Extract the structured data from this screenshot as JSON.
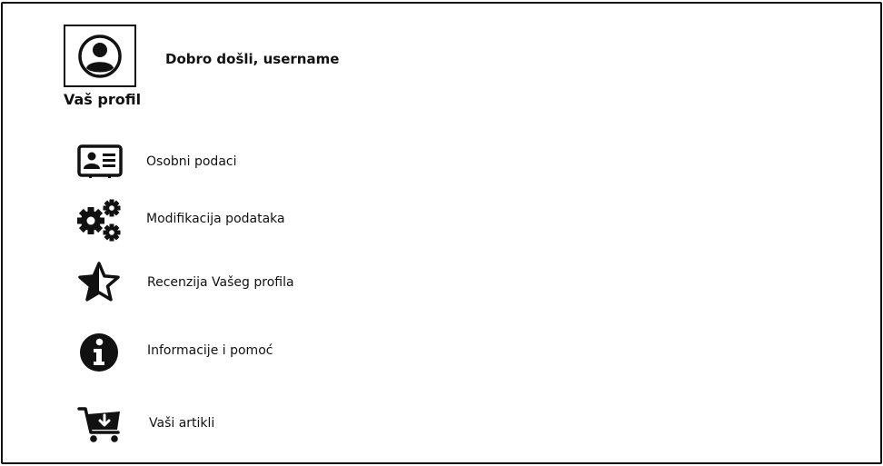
{
  "header": {
    "welcome_text": "Dobro došli, username",
    "profile_label": "Vaš profil",
    "avatar_icon": "user-avatar-icon"
  },
  "menu": {
    "items": [
      {
        "label": "Osobni podaci",
        "icon": "id-card-icon"
      },
      {
        "label": "Modifikacija podataka",
        "icon": "gears-icon"
      },
      {
        "label": "Recenzija Vašeg profila",
        "icon": "star-half-icon"
      },
      {
        "label": "Informacije i pomoć",
        "icon": "info-circle-icon"
      },
      {
        "label": "Vaši artikli",
        "icon": "cart-download-icon"
      }
    ]
  },
  "colors": {
    "ink": "#111111",
    "background": "#ffffff"
  }
}
